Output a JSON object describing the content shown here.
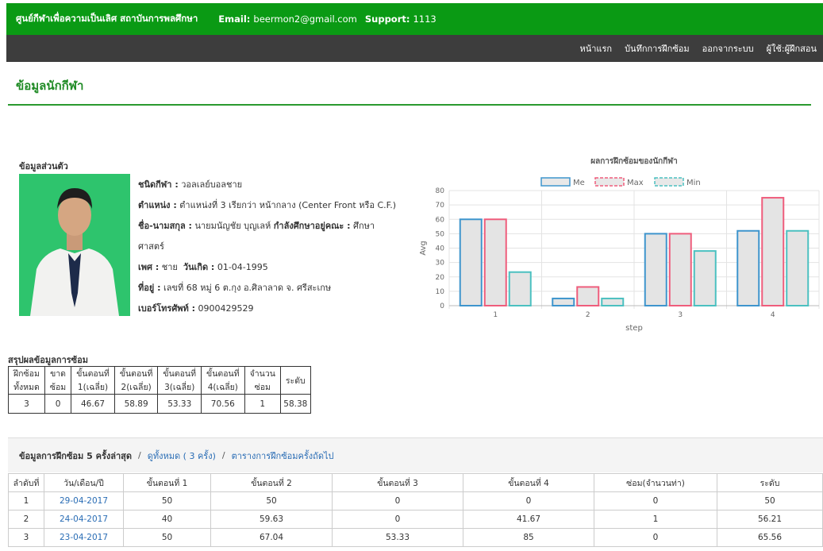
{
  "header": {
    "site_name": "ศูนย์กีฬาเพื่อความเป็นเลิศ สถาบันการพลศึกษา",
    "email_label": "Email:",
    "email": "beermon2@gmail.com",
    "support_label": "Support:",
    "support": "1113"
  },
  "nav": {
    "items": [
      "หน้าแรก",
      "บันทึกการฝึกซ้อม",
      "ออกจากระบบ",
      "ผู้ใช้:ผู้ฝึกสอน"
    ]
  },
  "page_title": "ข้อมูลนักกีฬา",
  "personal": {
    "heading": "ข้อมูลส่วนตัว",
    "sport_label": "ชนิดกีฬา :",
    "sport": "วอลเลย์บอลชาย",
    "position_label": "ตำแหน่ง :",
    "position": "ตำแหน่งที่ 3 เรียกว่า หน้ากลาง (Center Front หรือ C.F.)",
    "name_label": "ชื่อ-นามสกุล :",
    "name": "นายมนัญชัย บุญเลห์",
    "study_label": "กำลังศึกษาอยู่คณะ :",
    "study_part1": "ศึกษา",
    "study_part2": "ศาสตร์",
    "gender_label": "เพศ :",
    "gender": "ชาย",
    "birth_label": "วันเกิด :",
    "birth": "01-04-1995",
    "address_label": "ที่อยู่ :",
    "address": "เลขที่ 68 หมู่ 6 ต.กุง อ.ศิลาลาด จ. ศรีสะเกษ",
    "phone_label": "เบอร์โทรศัพท์ :",
    "phone": "0900429529"
  },
  "chart_data": {
    "type": "bar",
    "title": "ผลการฝึกซ้อมของนักกีฬา",
    "xlabel": "step",
    "ylabel": "Avg",
    "categories": [
      "1",
      "2",
      "3",
      "4"
    ],
    "ylim": [
      0,
      80
    ],
    "yticks": [
      0,
      10,
      20,
      30,
      40,
      50,
      60,
      70,
      80
    ],
    "legend_position": "top",
    "grid": true,
    "series": [
      {
        "name": "Me",
        "values": [
          60,
          5,
          50,
          52
        ],
        "color": "#3e95cd"
      },
      {
        "name": "Max",
        "values": [
          60,
          13,
          50,
          75
        ],
        "color": "#ef5d7c"
      },
      {
        "name": "Min",
        "values": [
          23.33,
          5,
          38,
          52
        ],
        "color": "#4bc0c0"
      }
    ]
  },
  "summary": {
    "heading": "สรุปผลข้อมูลการซ้อม",
    "headers": [
      [
        "ฝึกซ้อม",
        "ทั้งหมด"
      ],
      [
        "ขาด",
        "ซ้อม"
      ],
      [
        "ขั้นตอนที่",
        "1(เฉลี่ย)"
      ],
      [
        "ขั้นตอนที่",
        "2(เฉลี่ย)"
      ],
      [
        "ขั้นตอนที่",
        "3(เฉลี่ย)"
      ],
      [
        "ขั้นตอนที่",
        "4(เฉลี่ย)"
      ],
      [
        "จำนวน",
        "ซ่อม"
      ],
      [
        "ระดับ"
      ]
    ],
    "values": [
      "3",
      "0",
      "46.67",
      "58.89",
      "53.33",
      "70.56",
      "1",
      "58.38"
    ]
  },
  "recent": {
    "title": "ข้อมูลการฝึกซ้อม 5 ครั้งล่าสุด",
    "sep": "/",
    "view_all": "ดูทั้งหมด ( 3 ครั้ง)",
    "schedule": "ตารางการฝึกซ้อมครั้งถัดไป",
    "headers": [
      "ลำดับที่",
      "วัน/เดือน/ปี",
      "ขั้นตอนที่ 1",
      "ขั้นตอนที่ 2",
      "ขั้นตอนที่ 3",
      "ขั้นตอนที่ 4",
      "ซ่อม(จำนวนท่า)",
      "ระดับ"
    ],
    "rows": [
      [
        "1",
        "29-04-2017",
        "50",
        "50",
        "0",
        "0",
        "0",
        "50"
      ],
      [
        "2",
        "24-04-2017",
        "40",
        "59.63",
        "0",
        "41.67",
        "1",
        "56.21"
      ],
      [
        "3",
        "23-04-2017",
        "50",
        "67.04",
        "53.33",
        "85",
        "0",
        "65.56"
      ]
    ]
  }
}
